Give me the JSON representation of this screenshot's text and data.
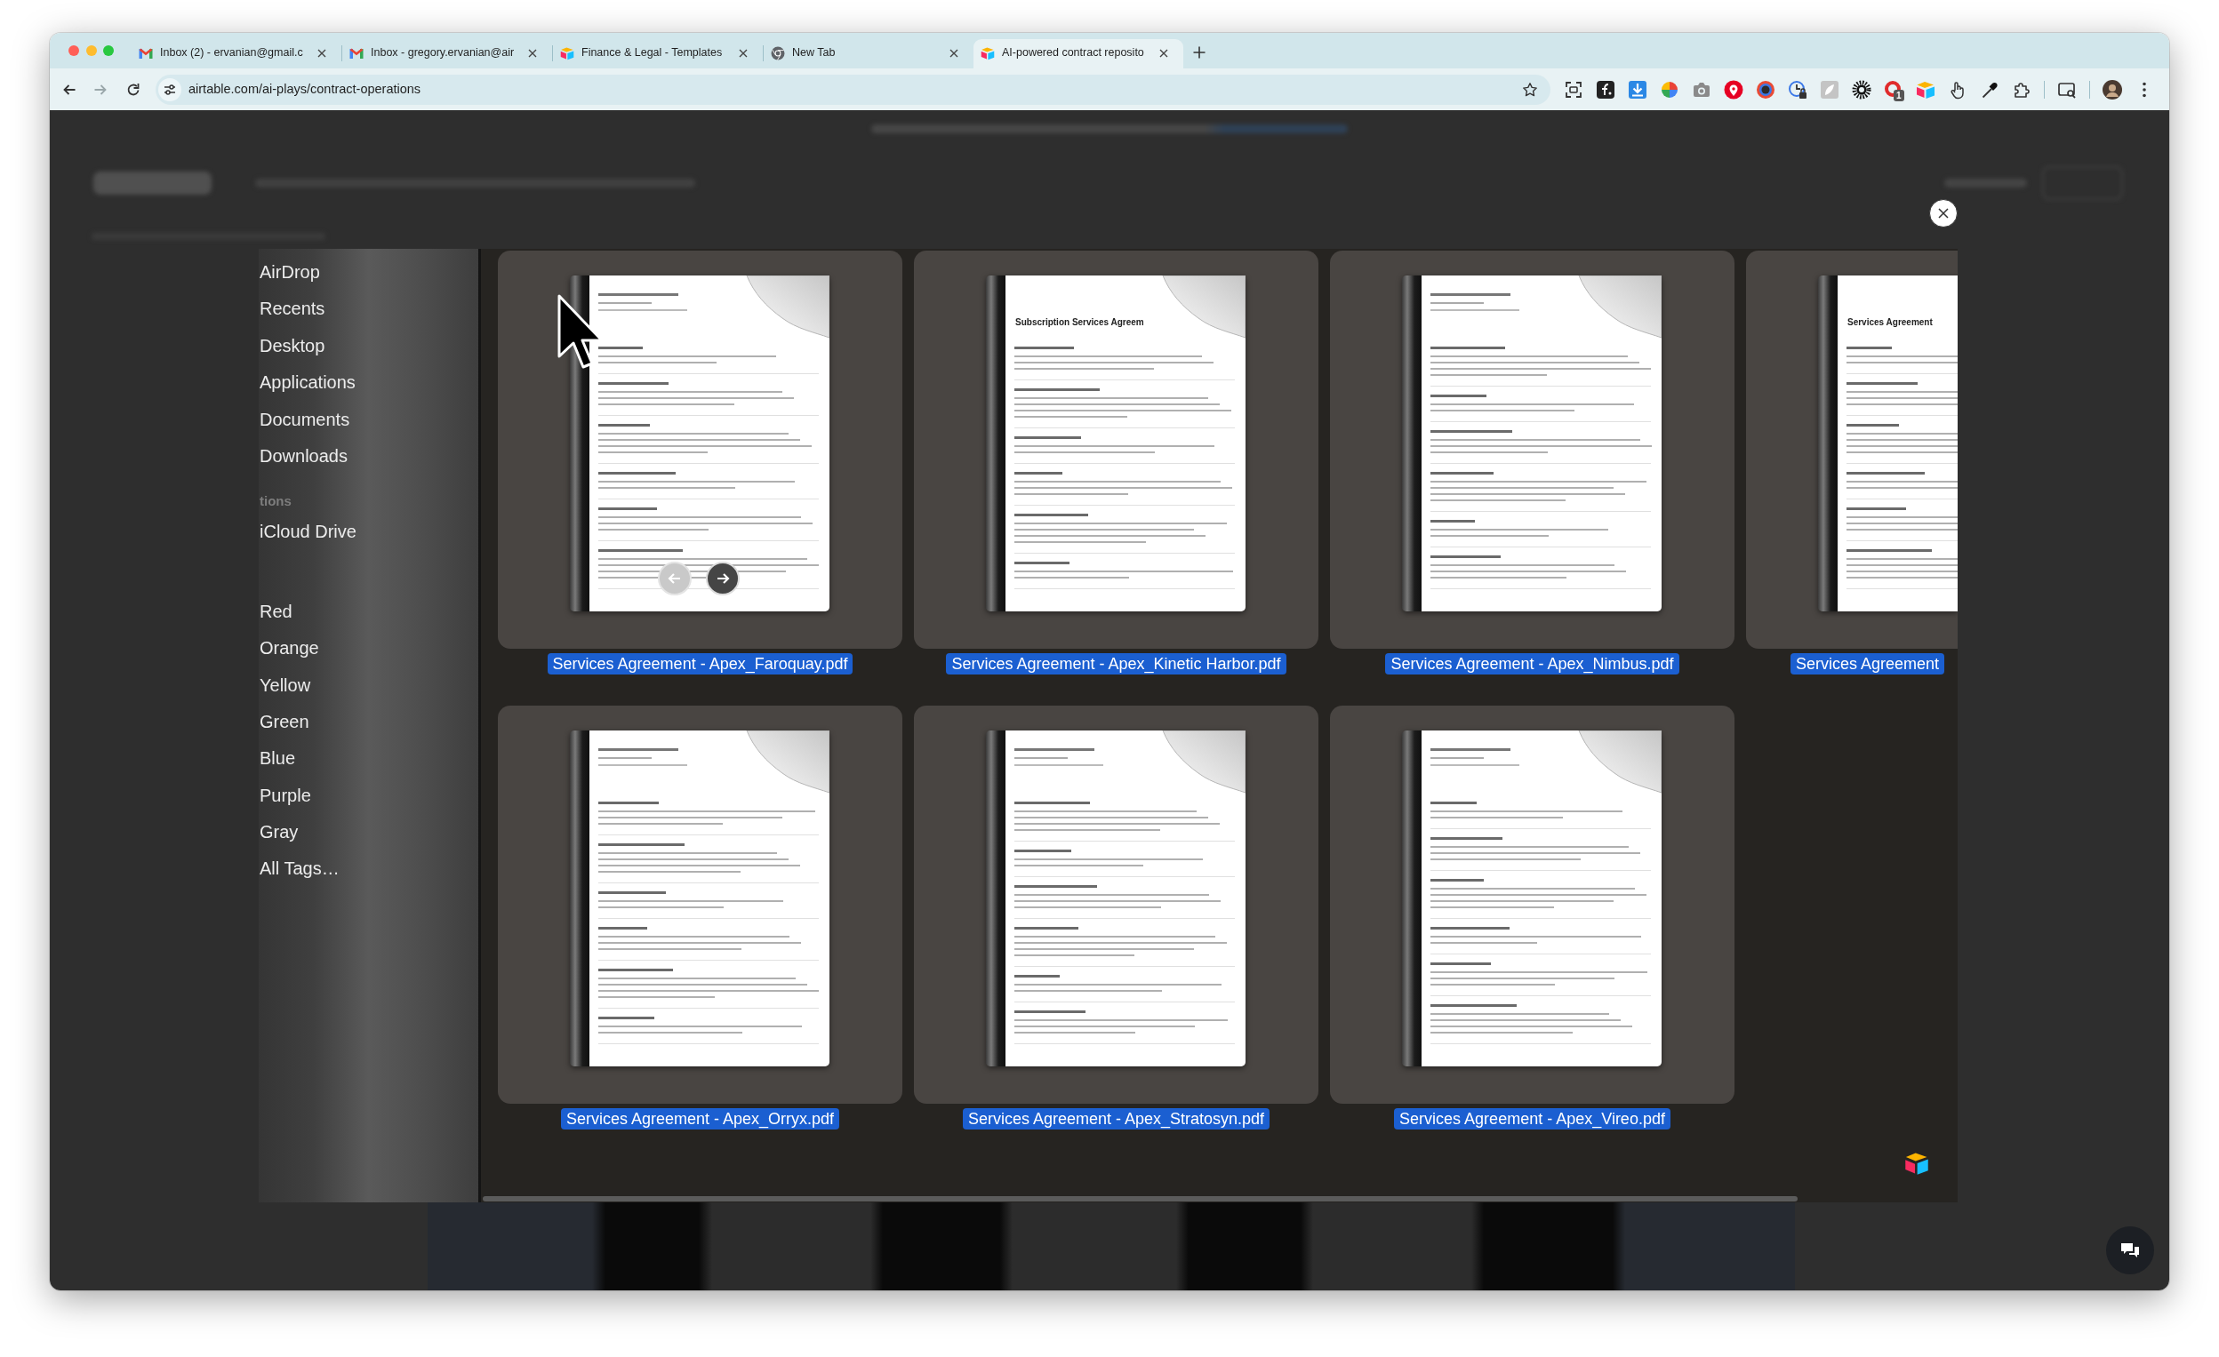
{
  "browser": {
    "tabs": [
      {
        "kind": "mail",
        "title": "Inbox (2) - ervanian@gmail.c",
        "selected": false
      },
      {
        "kind": "mail",
        "title": "Inbox - gregory.ervanian@air",
        "selected": false
      },
      {
        "kind": "base",
        "title": "Finance & Legal - Templates",
        "selected": false
      },
      {
        "kind": "newtab",
        "title": "New Tab",
        "selected": false
      },
      {
        "kind": "base",
        "title": "AI-powered contract reposito",
        "selected": true
      }
    ],
    "address": "airtable.com/ai-plays/contract-operations",
    "extension_badge": "1"
  },
  "finder": {
    "sidebar": [
      {
        "items": [
          "AirDrop",
          "Recents",
          "Desktop",
          "Applications",
          "Documents",
          "Downloads"
        ]
      },
      {
        "heading": "tions",
        "items": [
          "iCloud Drive"
        ]
      },
      {
        "items": [
          "Red",
          "Orange",
          "Yellow",
          "Green",
          "Blue",
          "Purple",
          "Gray",
          "All Tags…"
        ]
      }
    ],
    "files": [
      {
        "name": "Services Agreement - Apex_Faroquay.pdf",
        "selected": true,
        "page_arrows": [
          {
            "disabled": true
          },
          {
            "disabled": false
          }
        ]
      },
      {
        "name": "Services Agreement - Apex_Kinetic Harbor.pdf",
        "selected": true,
        "preview_title": "Subscription Services Agreem"
      },
      {
        "name": "Services Agreement - Apex_Nimbus.pdf",
        "selected": true
      },
      {
        "name": "Services Agreement",
        "selected": true,
        "preview_title": "Services Agreement"
      },
      {
        "name": "Services Agreement - Apex_Orryx.pdf",
        "selected": true
      },
      {
        "name": "Services Agreement - Apex_Stratosyn.pdf",
        "selected": true
      },
      {
        "name": "Services Agreement - Apex_Vireo.pdf",
        "selected": true
      }
    ]
  }
}
